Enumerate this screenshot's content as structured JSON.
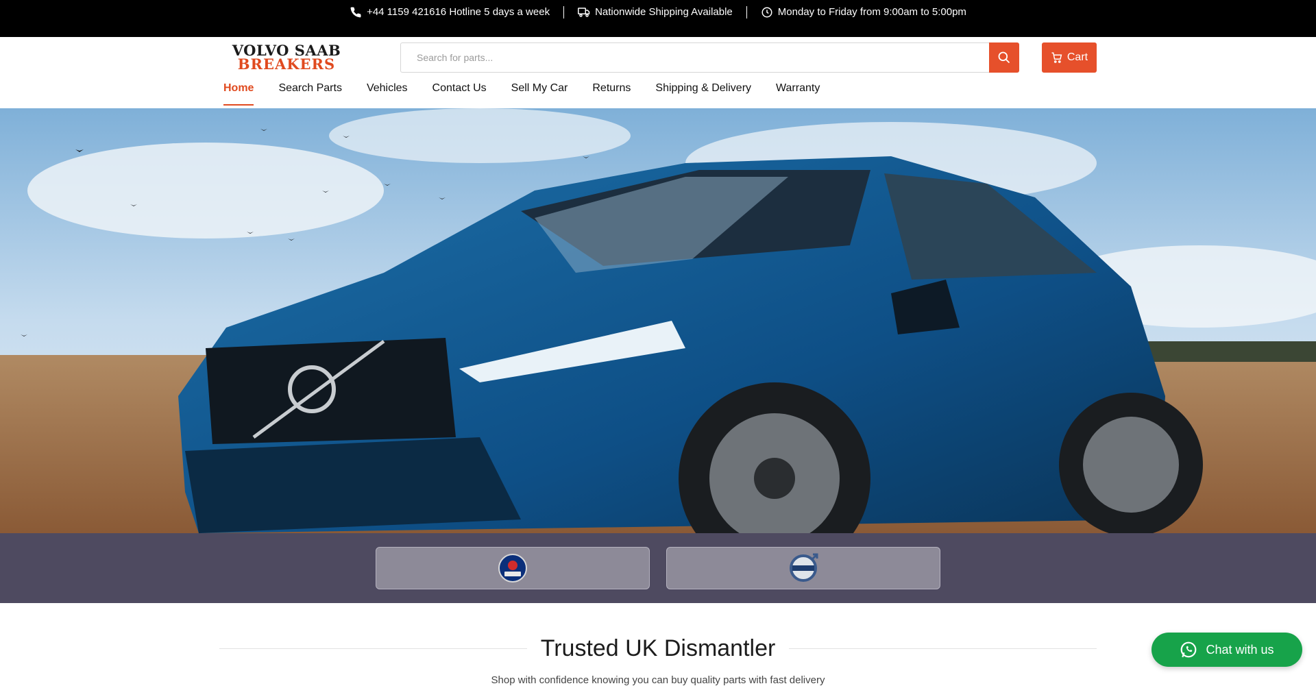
{
  "topbar": {
    "phone": "+44 1159 421616 Hotline 5 days a week",
    "shipping": "Nationwide Shipping Available",
    "hours": "Monday to Friday from 9:00am to 5:00pm"
  },
  "logo": {
    "line1": "VOLVO SAAB",
    "line2": "BREAKERS"
  },
  "search": {
    "placeholder": "Search for parts..."
  },
  "cart": {
    "label": "Cart"
  },
  "nav": {
    "items": [
      {
        "label": "Home",
        "active": true
      },
      {
        "label": "Search Parts"
      },
      {
        "label": "Vehicles"
      },
      {
        "label": "Contact Us"
      },
      {
        "label": "Sell My Car"
      },
      {
        "label": "Returns"
      },
      {
        "label": "Shipping & Delivery"
      },
      {
        "label": "Warranty"
      }
    ]
  },
  "brands": [
    {
      "name": "SAAB",
      "icon": "saab-logo-icon"
    },
    {
      "name": "VOLVO",
      "icon": "volvo-logo-icon"
    }
  ],
  "section": {
    "title": "Trusted UK Dismantler",
    "subtitle": "Shop with confidence knowing you can buy quality parts with fast delivery"
  },
  "chat": {
    "label": "Chat with us"
  },
  "colors": {
    "accent": "#e6502b",
    "topbar": "#000000",
    "brand_strip": "#4e4a60",
    "chat": "#17a34a"
  }
}
